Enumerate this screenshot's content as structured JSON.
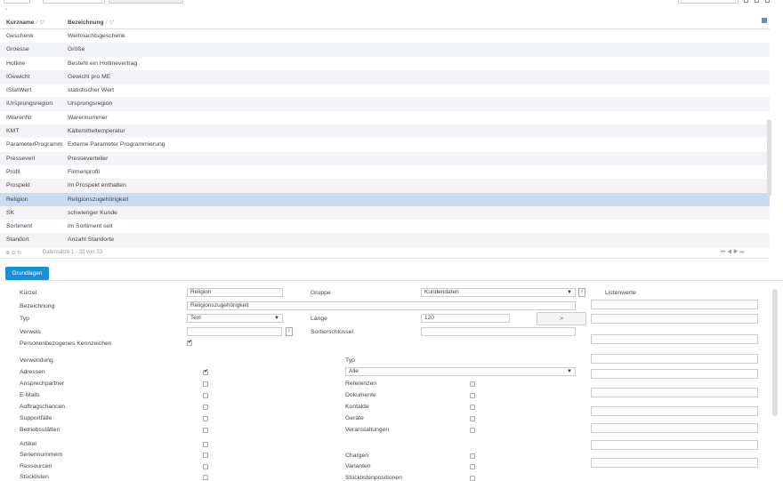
{
  "grid": {
    "headers": {
      "kurzname": "Kurzname",
      "bezeichnung": "Bezeichnung"
    },
    "rows": [
      {
        "k": "Geschenk",
        "b": "Weihnachtsgeschenk"
      },
      {
        "k": "Groesse",
        "b": "Größe"
      },
      {
        "k": "Hotline",
        "b": "Besteht ein Hotlinevertrag"
      },
      {
        "k": "IGewicht",
        "b": "Gewicht pro ME"
      },
      {
        "k": "IStatWert",
        "b": "statistischer Wert"
      },
      {
        "k": "IUrsprungsregion",
        "b": "Ursprungsregion"
      },
      {
        "k": "IWarenNr",
        "b": "Warennummer"
      },
      {
        "k": "KMT",
        "b": "Kältemitteltemperatur"
      },
      {
        "k": "ParameterProgramm",
        "b": "Externe Parameter Programmierung"
      },
      {
        "k": "Presseverl",
        "b": "Presseverteiler"
      },
      {
        "k": "Profil",
        "b": "Firmenprofil"
      },
      {
        "k": "Prospekt",
        "b": "im Prospekt enthalten"
      },
      {
        "k": "Religion",
        "b": "Religionszugehörigkeit"
      },
      {
        "k": "SK",
        "b": "schwieriger Kunde"
      },
      {
        "k": "Sortiment",
        "b": "im Sortiment seit"
      },
      {
        "k": "Standort",
        "b": "Anzahl Standorte"
      }
    ],
    "selected_index": 12,
    "footer_status": "Datensätze 1 - 33 von 33",
    "footer_icons": "⊕ ⊖ ↻",
    "pager": "⏮ ◀ ▶ ⏭"
  },
  "tab": {
    "label": "Grundlagen"
  },
  "form": {
    "kuerzel_label": "Kürzel",
    "kuerzel_value": "Religion",
    "gruppe_label": "Gruppe",
    "gruppe_value": "Kundendaten",
    "listenwerte_label": "Listenwerte",
    "bezeichnung_label": "Bezeichnung",
    "bezeichnung_value": "Religionszugehörigkeit",
    "typ_label": "Typ",
    "typ_value": "Text",
    "laenge_label": "Länge",
    "laenge_value": "120",
    "laenge_button": ">",
    "verweis_label": "Verweis",
    "sort_label": "Sortierschlüssel",
    "personen_label": "Personenbezogenes Kennzeichen",
    "verwendung_label": "Verwendung",
    "typ2_label": "Typ",
    "typ2_value": "Alle",
    "left_items": [
      {
        "label": "Adressen",
        "checked": true
      },
      {
        "label": "Ansprechpartner",
        "checked": false
      },
      {
        "label": "E-Mails",
        "checked": false
      },
      {
        "label": "Auftragschancen",
        "checked": false
      },
      {
        "label": "Supportfälle",
        "checked": false
      },
      {
        "label": "Betriebsstätten",
        "checked": false
      }
    ],
    "left_items2": [
      {
        "label": "Artikel",
        "checked": false
      },
      {
        "label": "Seriennummern",
        "checked": false
      },
      {
        "label": "Ressourcen",
        "checked": false
      },
      {
        "label": "Stücklisten",
        "checked": false
      }
    ],
    "right_items": [
      {
        "label": "Referenzen",
        "checked": false
      },
      {
        "label": "Dokumente",
        "checked": false
      },
      {
        "label": "Kontakte",
        "checked": false
      },
      {
        "label": "Geräte",
        "checked": false
      },
      {
        "label": "Veranstaltungen",
        "checked": false
      }
    ],
    "right_items2": [
      {
        "label": "Chargen",
        "checked": false
      },
      {
        "label": "Varianten",
        "checked": false
      },
      {
        "label": "Stücklistenpositionen",
        "checked": false
      }
    ]
  }
}
